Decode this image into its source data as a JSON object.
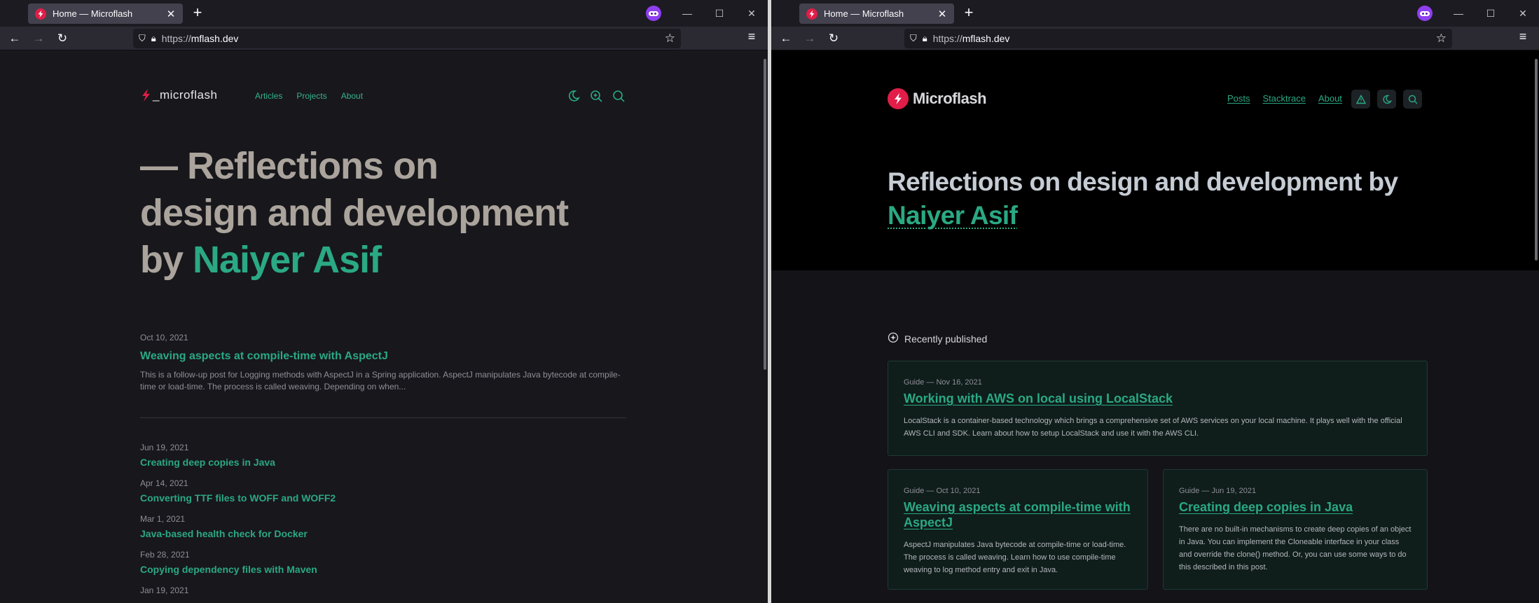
{
  "left": {
    "browser": {
      "tab_title": "Home — Microflash",
      "url_prefix": "https://",
      "url_host": "mflash.dev"
    },
    "site": {
      "logo_text": "_microflash",
      "nav": [
        "Articles",
        "Projects",
        "About"
      ],
      "hero_line1": "— Reflections on",
      "hero_line2": "design and development",
      "hero_by": "by ",
      "hero_name": "Naiyer Asif"
    },
    "featured": {
      "date": "Oct 10, 2021",
      "title": "Weaving aspects at compile-time with AspectJ",
      "excerpt": "This is a follow-up post for Logging methods with AspectJ in a Spring application. AspectJ manipulates Java bytecode at compile-time or load-time. The process is called weaving. Depending on when..."
    },
    "posts": [
      {
        "date": "Jun 19, 2021",
        "title": "Creating deep copies in Java"
      },
      {
        "date": "Apr 14, 2021",
        "title": "Converting TTF files to WOFF and WOFF2"
      },
      {
        "date": "Mar 1, 2021",
        "title": "Java-based health check for Docker"
      },
      {
        "date": "Feb 28, 2021",
        "title": "Copying dependency files with Maven"
      },
      {
        "date": "Jan 19, 2021",
        "title": ""
      }
    ]
  },
  "right": {
    "browser": {
      "tab_title": "Home — Microflash",
      "url_prefix": "https://",
      "url_host": "mflash.dev"
    },
    "site": {
      "logo_text": "Microflash",
      "nav": [
        "Posts",
        "Stacktrace",
        "About"
      ],
      "hero_text": "Reflections on design and development by ",
      "hero_name": "Naiyer Asif",
      "recent_heading": "Recently published"
    },
    "cards": [
      {
        "meta": "Guide — Nov 16, 2021",
        "title": "Working with AWS on local using LocalStack",
        "body": "LocalStack is a container-based technology which brings a comprehensive set of AWS services on your local machine. It plays well with the official AWS CLI and SDK. Learn about how to setup LocalStack and use it with the AWS CLI."
      },
      {
        "meta": "Guide — Oct 10, 2021",
        "title": "Weaving aspects at compile-time with AspectJ",
        "body": "AspectJ manipulates Java bytecode at compile-time or load-time. The process is called weaving. Learn how to use compile-time weaving to log method entry and exit in Java."
      },
      {
        "meta": "Guide — Jun 19, 2021",
        "title": "Creating deep copies in Java",
        "body": "There are no built-in mechanisms to create deep copies of an object in Java. You can implement the Cloneable interface in your class and override the clone() method. Or, you can use some ways to do this described in this post."
      }
    ]
  },
  "colors": {
    "accent_green": "#2aa983",
    "brand_red": "#e11d48",
    "firefox_toolbar": "#2b2a33"
  }
}
